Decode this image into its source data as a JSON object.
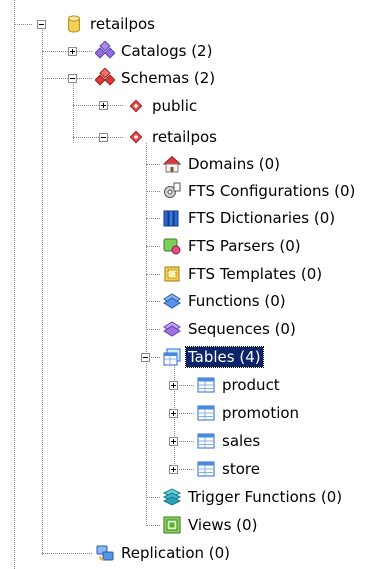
{
  "tree": {
    "root": {
      "label": "retailpos",
      "expanded": true,
      "icon": "database-icon"
    },
    "catalogs": {
      "label": "Catalogs (2)",
      "expanded": false,
      "icon": "catalogs-icon"
    },
    "schemas": {
      "label": "Schemas (2)",
      "expanded": true,
      "icon": "schemas-icon"
    },
    "schema_public": {
      "label": "public",
      "expanded": false,
      "icon": "schema-icon"
    },
    "schema_retailpos": {
      "label": "retailpos",
      "expanded": true,
      "icon": "schema-icon"
    },
    "objects": [
      {
        "label": "Domains (0)",
        "icon": "domains-icon"
      },
      {
        "label": "FTS Configurations (0)",
        "icon": "fts-configurations-icon"
      },
      {
        "label": "FTS Dictionaries (0)",
        "icon": "fts-dictionaries-icon"
      },
      {
        "label": "FTS Parsers (0)",
        "icon": "fts-parsers-icon"
      },
      {
        "label": "FTS Templates (0)",
        "icon": "fts-templates-icon"
      },
      {
        "label": "Functions (0)",
        "icon": "functions-icon"
      },
      {
        "label": "Sequences (0)",
        "icon": "sequences-icon"
      }
    ],
    "tables": {
      "label": "Tables (4)",
      "expanded": true,
      "selected": true,
      "icon": "tables-icon"
    },
    "table_items": [
      {
        "label": "product",
        "icon": "table-icon"
      },
      {
        "label": "promotion",
        "icon": "table-icon"
      },
      {
        "label": "sales",
        "icon": "table-icon"
      },
      {
        "label": "store",
        "icon": "table-icon"
      }
    ],
    "trigger_functions": {
      "label": "Trigger Functions (0)",
      "icon": "trigger-functions-icon"
    },
    "views": {
      "label": "Views (0)",
      "icon": "views-icon"
    },
    "replication": {
      "label": "Replication (0)",
      "icon": "replication-icon"
    }
  },
  "colors": {
    "selection": "#0a246a",
    "tree_lines": "#8a8a8a",
    "schema_red": "#d83a3a",
    "catalog_purple": "#8a6ad0",
    "table_blue": "#4a8ad8",
    "view_green": "#5fb030"
  }
}
